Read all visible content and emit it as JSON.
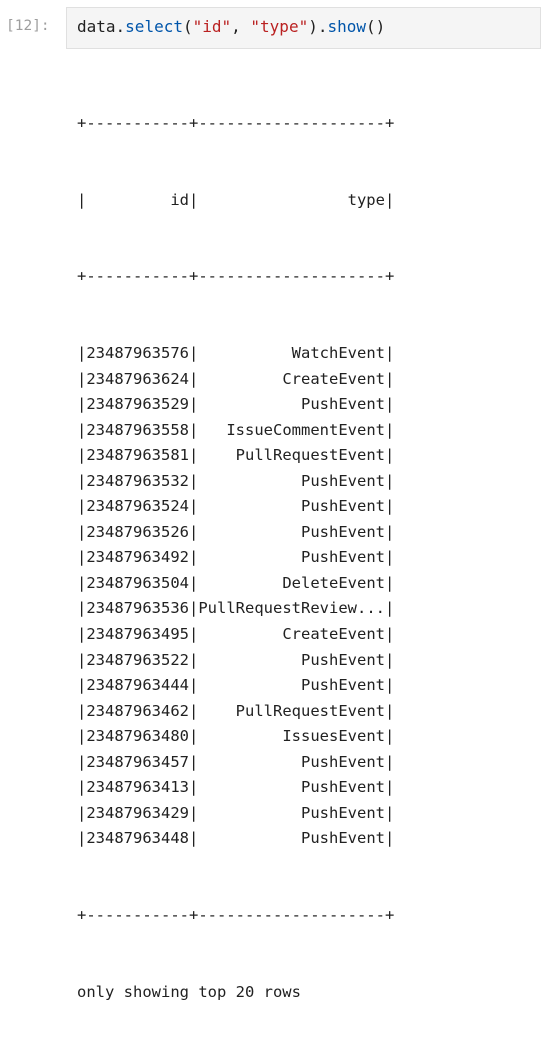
{
  "cell": {
    "prompt": "[12]:",
    "code": {
      "object": "data",
      "dot1": ".",
      "method1": "select",
      "open1": "(",
      "arg1": "\"id\"",
      "comma": ", ",
      "arg2": "\"type\"",
      "close1": ")",
      "dot2": ".",
      "method2": "show",
      "parens2": "()"
    }
  },
  "output": {
    "border_line": "+-----------+--------------------+",
    "header_line": "|         id|                type|",
    "columns": [
      "id",
      "type"
    ],
    "rows": [
      {
        "id": "23487963576",
        "type": "WatchEvent"
      },
      {
        "id": "23487963624",
        "type": "CreateEvent"
      },
      {
        "id": "23487963529",
        "type": "PushEvent"
      },
      {
        "id": "23487963558",
        "type": "IssueCommentEvent"
      },
      {
        "id": "23487963581",
        "type": "PullRequestEvent"
      },
      {
        "id": "23487963532",
        "type": "PushEvent"
      },
      {
        "id": "23487963524",
        "type": "PushEvent"
      },
      {
        "id": "23487963526",
        "type": "PushEvent"
      },
      {
        "id": "23487963492",
        "type": "PushEvent"
      },
      {
        "id": "23487963504",
        "type": "DeleteEvent"
      },
      {
        "id": "23487963536",
        "type": "PullRequestReview..."
      },
      {
        "id": "23487963495",
        "type": "CreateEvent"
      },
      {
        "id": "23487963522",
        "type": "PushEvent"
      },
      {
        "id": "23487963444",
        "type": "PushEvent"
      },
      {
        "id": "23487963462",
        "type": "PullRequestEvent"
      },
      {
        "id": "23487963480",
        "type": "IssuesEvent"
      },
      {
        "id": "23487963457",
        "type": "PushEvent"
      },
      {
        "id": "23487963413",
        "type": "PushEvent"
      },
      {
        "id": "23487963429",
        "type": "PushEvent"
      },
      {
        "id": "23487963448",
        "type": "PushEvent"
      }
    ],
    "footer": "only showing top 20 rows"
  }
}
